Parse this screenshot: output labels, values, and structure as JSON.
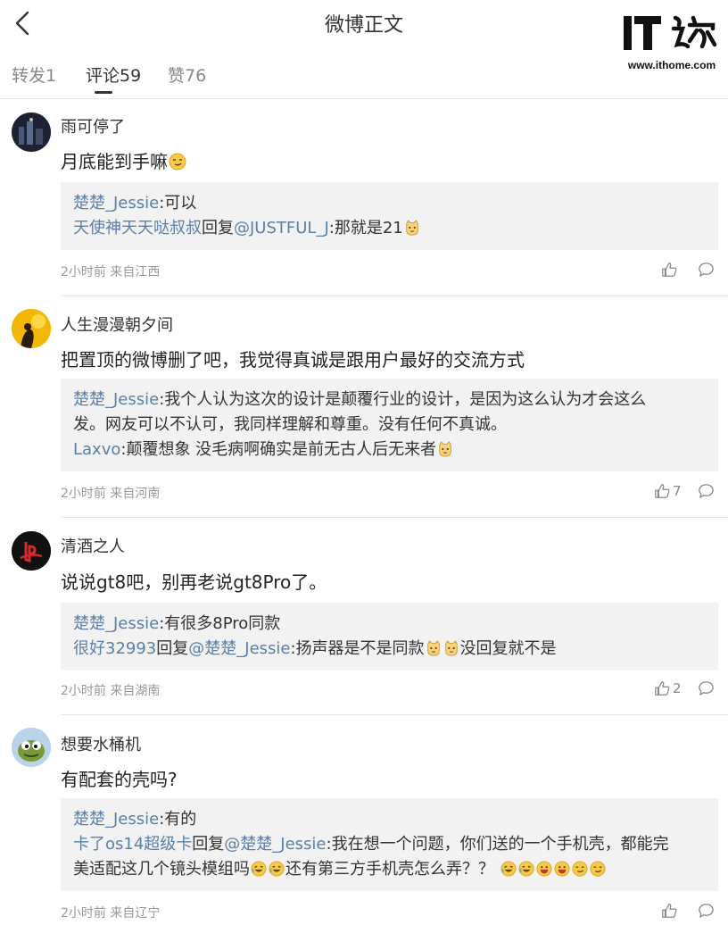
{
  "header": {
    "back_icon": "chevron-left-icon",
    "title": "微博正文"
  },
  "watermark": {
    "logo_text": "IT之家",
    "site": "www.ithome.com"
  },
  "tabs": [
    {
      "label": "转发1",
      "active": false
    },
    {
      "label": "评论59",
      "active": true
    },
    {
      "label": "赞76",
      "active": false
    }
  ],
  "comments": [
    {
      "user": "雨可停了",
      "text": "月底能到手嘛",
      "emoji": "smug-face-emoji",
      "replies": [
        {
          "user": "楚楚_Jessie",
          "text": ":可以"
        },
        {
          "user": "天使神天天哒叔叔",
          "reply_word": "回复",
          "mention": "@JUSTFUL_J",
          "text": ":那就是21",
          "emoji": "cat-face-emoji"
        }
      ],
      "meta": "2小时前 来自江西",
      "likes": ""
    },
    {
      "user": "人生漫漫朝夕间",
      "text": "把置顶的微博删了吧，我觉得真诚是跟用户最好的交流方式",
      "replies": [
        {
          "user": "楚楚_Jessie",
          "text": ":我个人认为这次的设计是颠覆行业的设计，是因为这么认为才会这么",
          "text2": "发。网友可以不认可，我同样理解和尊重。没有任何不真诚。"
        },
        {
          "user": "Laxvo",
          "text": ":颠覆想象 没毛病啊确实是前无古人后无来者",
          "emoji": "cat-face-emoji"
        }
      ],
      "meta": "2小时前 来自河南",
      "likes": "7"
    },
    {
      "user": "清酒之人",
      "text": "说说gt8吧，别再老说gt8Pro了。",
      "replies": [
        {
          "user": "楚楚_Jessie",
          "text": ":有很多8Pro同款"
        },
        {
          "user": "很好32993",
          "reply_word": "回复",
          "mention": "@楚楚_Jessie",
          "text": ":扬声器是不是同款",
          "text_after": "没回复就不是",
          "emoji": "cat-face-emoji"
        }
      ],
      "meta": "2小时前 来自湖南",
      "likes": "2"
    },
    {
      "user": "想要水桶机",
      "text": "有配套的壳吗?",
      "replies": [
        {
          "user": "楚楚_Jessie",
          "text": ":有的"
        },
        {
          "user": "卡了os14超级卡",
          "reply_word": "回复",
          "mention": "@楚楚_Jessie",
          "text": ":我在想一个问题，你们送的一个手机壳，都能完",
          "text2": "美适配这几个镜头模组吗",
          "text3": "还有第三方手机壳怎么弄？？"
        }
      ],
      "meta": "2小时前 来自辽宁",
      "likes": ""
    }
  ],
  "icons": {
    "like": "thumbs-up-icon",
    "reply": "speech-bubble-icon"
  },
  "colors": {
    "link": "#5b7fa8",
    "reply_bg": "#f2f2f2",
    "meta": "#999999"
  }
}
